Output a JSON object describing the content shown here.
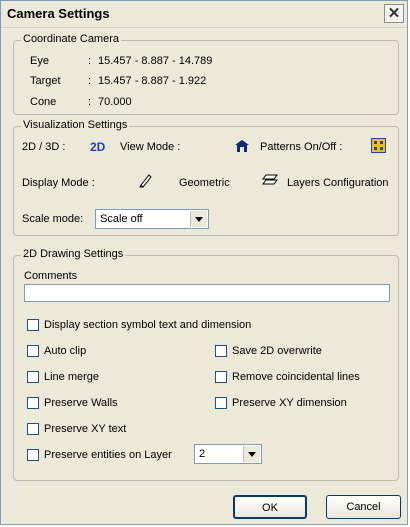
{
  "window": {
    "title": "Camera Settings",
    "close_glyph": "✕"
  },
  "coordinate_camera": {
    "legend": "Coordinate Camera",
    "rows": [
      {
        "label": "Eye",
        "sep": ":",
        "value": "15.457 - 8.887 - 14.789"
      },
      {
        "label": "Target",
        "sep": ":",
        "value": "15.457 - 8.887 - 1.922"
      },
      {
        "label": "Cone",
        "sep": ":",
        "value": "70.000"
      }
    ]
  },
  "visualization": {
    "legend": "Visualization Settings",
    "mode_label": "2D / 3D :",
    "mode_value": "2D",
    "view_mode_label": "View Mode :",
    "patterns_label": "Patterns On/Off :",
    "display_mode_label": "Display Mode :",
    "geometric_label": "Geometric",
    "layers_label": "Layers Configuration",
    "scale_mode_label": "Scale mode:",
    "scale_mode_value": "Scale off",
    "accent_color": "#1c3fd1"
  },
  "drawing": {
    "legend": "2D Drawing Settings",
    "comments_label": "Comments",
    "comments_value": "",
    "checks": {
      "display_section": "Display section symbol text and dimension",
      "auto_clip": "Auto clip",
      "save_2d_overwrite": "Save 2D overwrite",
      "line_merge": "Line merge",
      "remove_coincidental": "Remove coincidental lines",
      "preserve_walls": "Preserve Walls",
      "preserve_xy_dimension": "Preserve XY dimension",
      "preserve_xy_text": "Preserve XY text",
      "preserve_entities": "Preserve entities on Layer"
    },
    "layer_value": "2"
  },
  "buttons": {
    "ok": "OK",
    "cancel": "Cancel"
  }
}
